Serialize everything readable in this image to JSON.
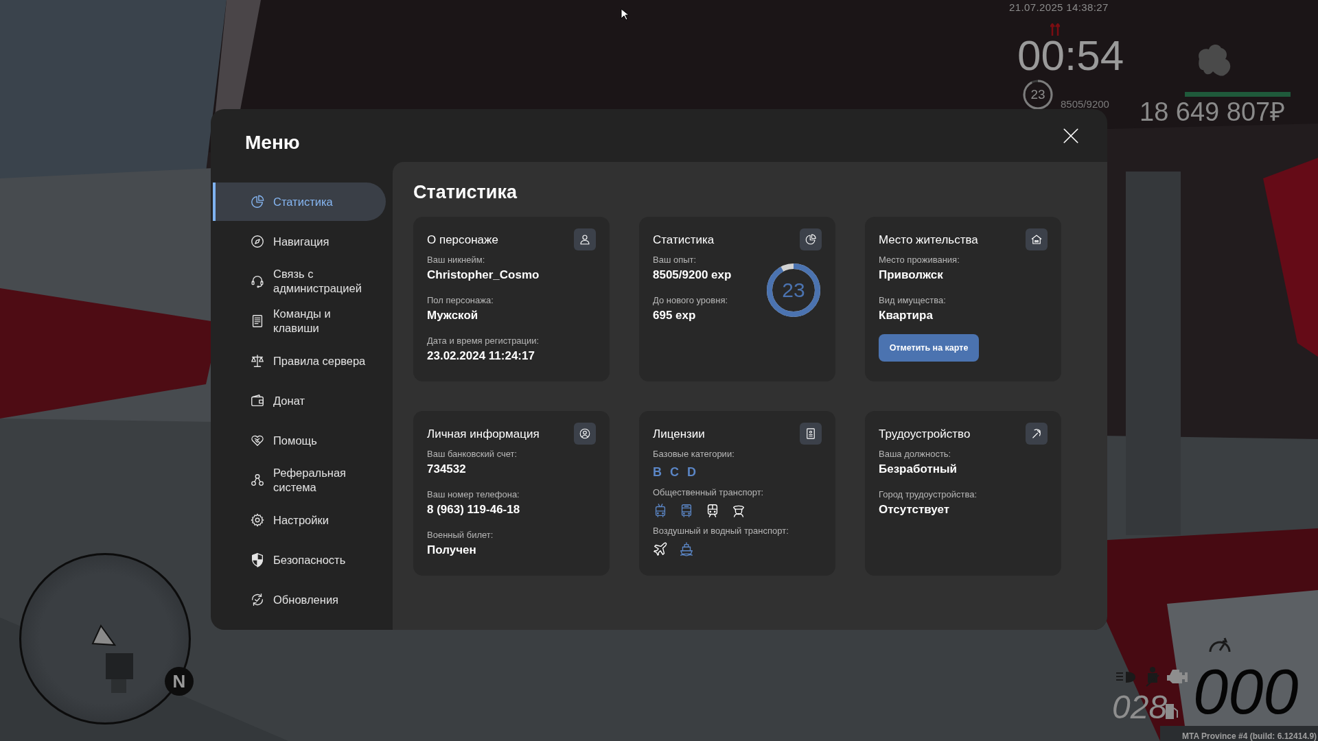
{
  "hud": {
    "datetime": "21.07.2025 14:38:27",
    "timer": "00:54",
    "level_badge": {
      "text": "23",
      "level": 0.92
    },
    "exp": "8505/9200",
    "money_bar": {
      "level": 1
    },
    "money": "18 649 807₽",
    "compass": "N",
    "speed": "000",
    "fuel": "028",
    "build": "MTA Province #4 (build: 6.12414.9)"
  },
  "menu": {
    "title": "Меню",
    "sidebar": {
      "items": [
        {
          "label": "Статистика",
          "selected": true
        },
        {
          "label": "Навигация",
          "selected": false
        },
        {
          "label": "Связь с администрацией",
          "selected": false
        },
        {
          "label": "Команды и клавиши",
          "selected": false
        },
        {
          "label": "Правила сервера",
          "selected": false
        },
        {
          "label": "Донат",
          "selected": false
        },
        {
          "label": "Помощь",
          "selected": false
        },
        {
          "label": "Реферальная система",
          "selected": false
        },
        {
          "label": "Настройки",
          "selected": false
        },
        {
          "label": "Безопасность",
          "selected": false
        },
        {
          "label": "Обновления",
          "selected": false
        }
      ]
    },
    "content": {
      "title": "Статистика",
      "cards": [
        {
          "kind": "info",
          "title": "О персонаже",
          "fields": [
            {
              "label": "Ваш никнейм:",
              "value": "Christopher_Cosmo"
            },
            {
              "label": "Пол персонажа:",
              "value": "Мужской"
            },
            {
              "label": "Дата и время регистрации:",
              "value": "23.02.2024 11:24:17"
            }
          ]
        },
        {
          "kind": "progress",
          "title": "Статистика",
          "fields": [
            {
              "label": "Ваш опыт:",
              "value": "8505/9200 exp"
            },
            {
              "label": "До нового уровня:",
              "value": "695 exp"
            }
          ],
          "ring": {
            "text": "23",
            "level": 0.92
          }
        },
        {
          "kind": "info",
          "title": "Место жительства",
          "fields": [
            {
              "label": "Место проживания:",
              "value": "Приволжск"
            },
            {
              "label": "Вид имущества:",
              "value": "Квартира"
            }
          ],
          "button": "Отметить на карте"
        },
        {
          "kind": "info",
          "title": "Личная информация",
          "fields": [
            {
              "label": "Ваш банковский счет:",
              "value": "734532"
            },
            {
              "label": "Ваш номер телефона:",
              "value": "8 (963) 119-46-18"
            },
            {
              "label": "Военный билет:",
              "value": "Получен"
            }
          ]
        },
        {
          "kind": "licenses",
          "title": "Лицензии",
          "sections": [
            {
              "kind": "letters",
              "label": "Базовые категории:",
              "items": [
                {
                  "text": "B",
                  "obtained": true
                },
                {
                  "text": "C",
                  "obtained": true
                },
                {
                  "text": "D",
                  "obtained": true
                }
              ]
            },
            {
              "kind": "icons",
              "label": "Общественный транспорт:",
              "items": [
                {
                  "obtained": true
                },
                {
                  "obtained": true
                },
                {
                  "obtained": false
                },
                {
                  "obtained": false
                }
              ]
            },
            {
              "kind": "icons",
              "label": "Воздушный и водный транспорт:",
              "items": [
                {
                  "obtained": false
                },
                {
                  "obtained": true
                }
              ]
            }
          ]
        },
        {
          "kind": "info",
          "title": "Трудоустройство",
          "fields": [
            {
              "label": "Ваша должность:",
              "value": "Безработный"
            },
            {
              "label": "Город трудоустройства:",
              "value": "Отсутствует"
            }
          ]
        }
      ]
    }
  }
}
